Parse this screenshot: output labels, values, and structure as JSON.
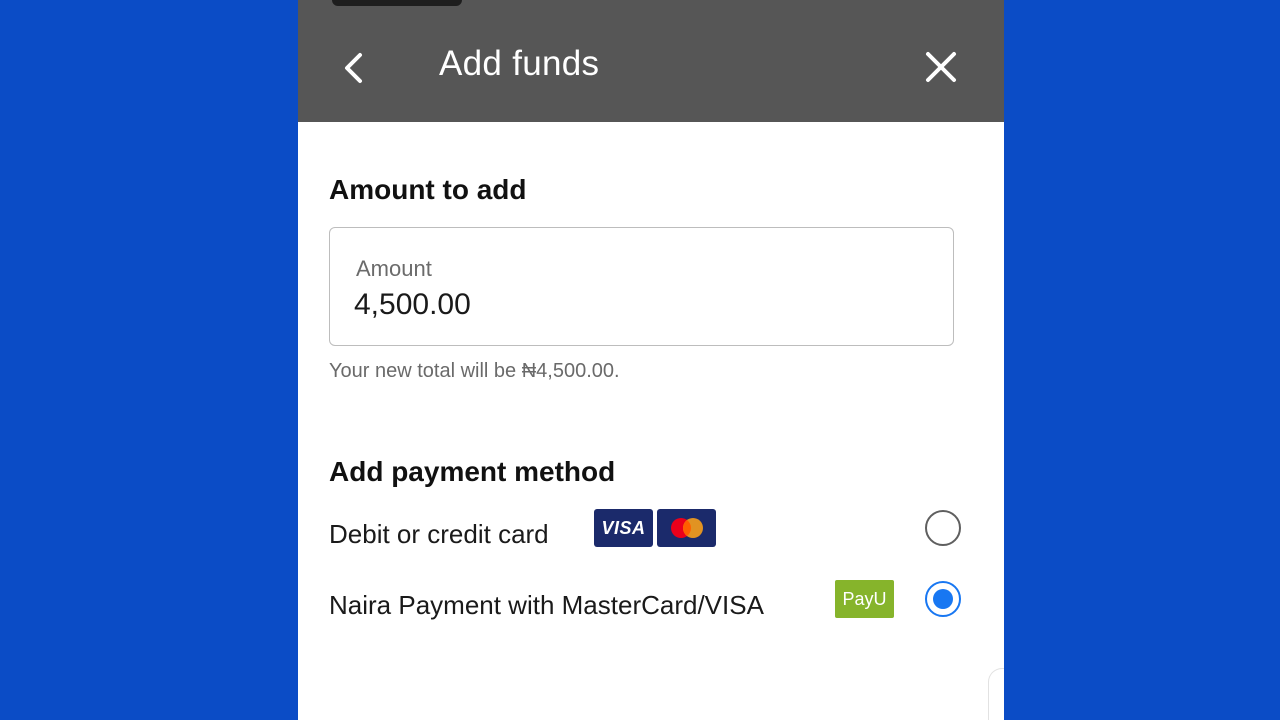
{
  "header": {
    "title": "Add funds",
    "back_icon": "chevron-left-icon",
    "close_icon": "close-icon",
    "background": "#565656"
  },
  "amount_section": {
    "heading": "Amount to add",
    "field_label": "Amount",
    "field_value": "4,500.00",
    "helper": "Your new total will be ₦4,500.00."
  },
  "payment_section": {
    "heading": "Add payment method",
    "methods": [
      {
        "label": "Debit or credit card",
        "logos": [
          "VISA",
          "mastercard-logo"
        ],
        "selected": false
      },
      {
        "label": "Naira Payment with MasterCard/VISA",
        "logos": [
          "PayU"
        ],
        "selected": true
      }
    ]
  },
  "colors": {
    "page_background": "#0b4cc6",
    "accent": "#1877f2",
    "payu_green": "#86b42b",
    "visa_navy": "#1b2a6b"
  }
}
